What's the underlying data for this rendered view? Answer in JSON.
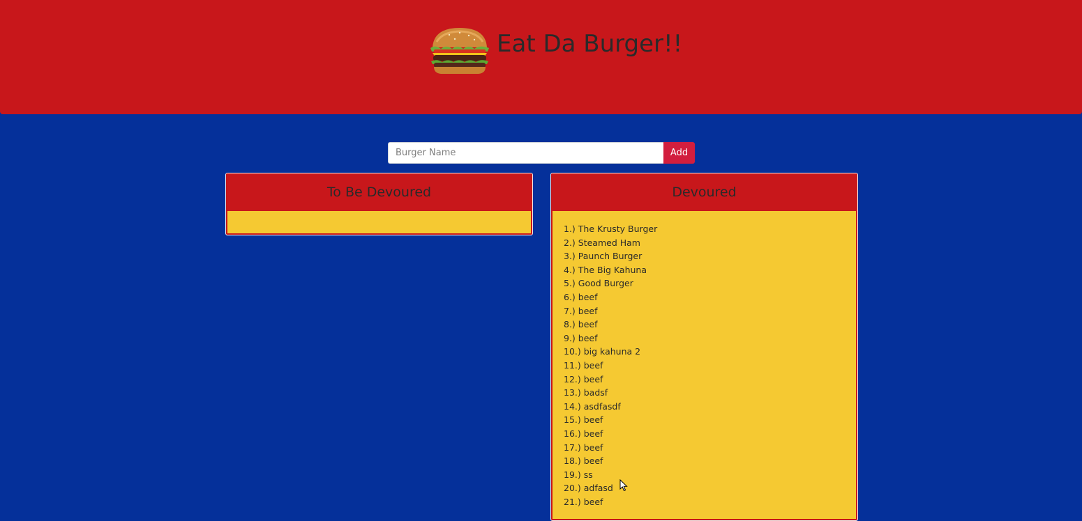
{
  "header": {
    "title": "Eat Da Burger!!",
    "logo_icon": "burger-icon"
  },
  "form": {
    "placeholder": "Burger Name",
    "value": "",
    "add_label": "Add"
  },
  "panels": {
    "to_be_devoured": {
      "title": "To Be Devoured",
      "items": []
    },
    "devoured": {
      "title": "Devoured",
      "items": [
        "1.) The Krusty Burger",
        "2.) Steamed Ham",
        "3.) Paunch Burger",
        "4.) The Big Kahuna",
        "5.) Good Burger",
        "6.) beef",
        "7.) beef",
        "8.) beef",
        "9.) beef",
        "10.) big kahuna 2",
        "11.) beef",
        "12.) beef",
        "13.) badsf",
        "14.) asdfasdf",
        "15.) beef",
        "16.) beef",
        "17.) beef",
        "18.) beef",
        "19.) ss",
        "20.) adfasd",
        "21.) beef"
      ]
    }
  },
  "colors": {
    "header_bg": "#c8171b",
    "page_bg": "#05309a",
    "panel_body": "#f5c932",
    "button": "#d21e3e"
  }
}
